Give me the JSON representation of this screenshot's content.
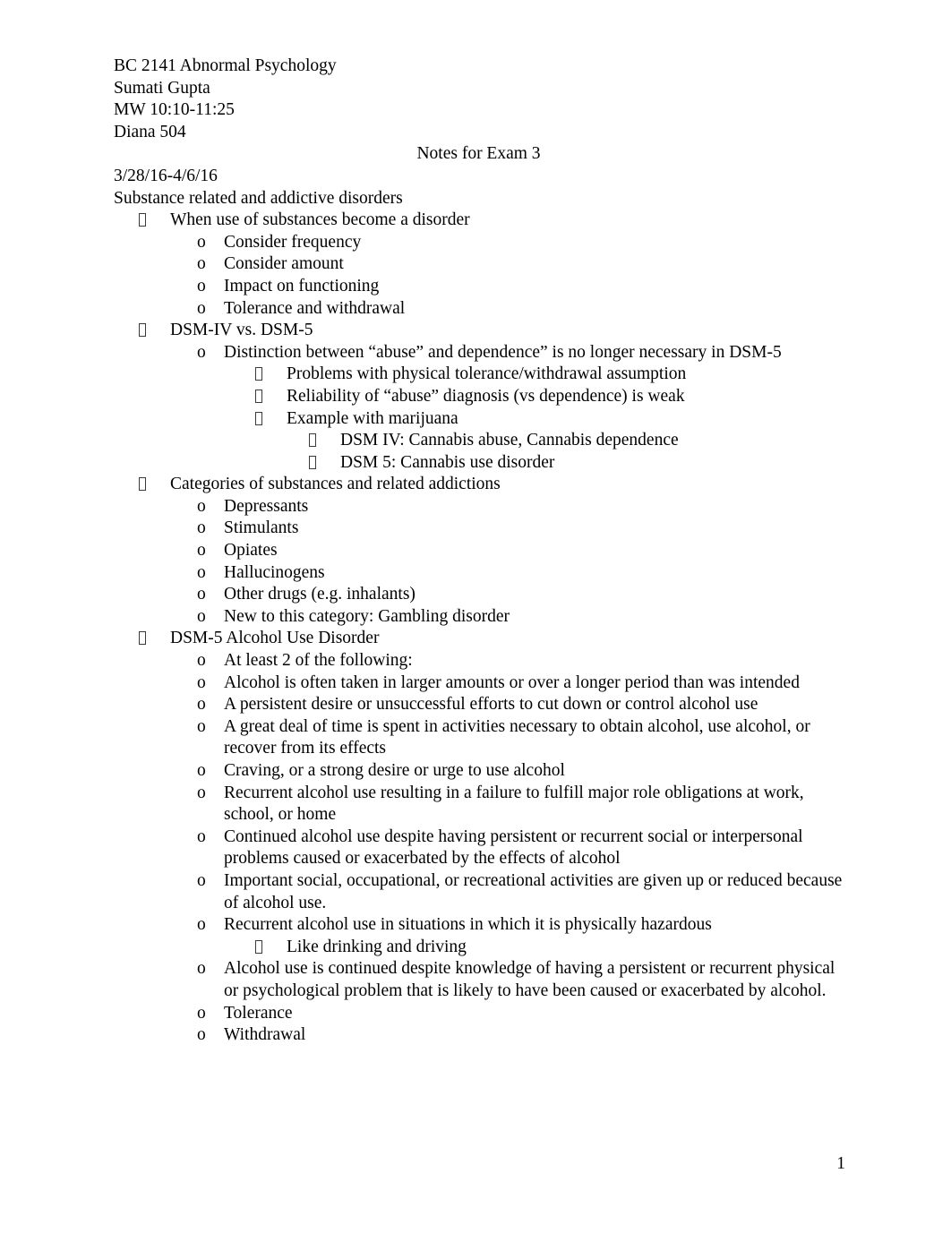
{
  "document": {
    "header": {
      "course": "BC 2141 Abnormal Psychology",
      "instructor": "Sumati Gupta",
      "schedule": "MW 10:10-11:25",
      "room": "Diana 504",
      "title": "Notes for Exam 3",
      "date_range": "3/28/16-4/6/16"
    },
    "section_heading": "Substance related and addictive disorders",
    "page_number": "1",
    "bullets": {
      "level1_glyph": "missing-glyph-box",
      "level2_glyph": "o",
      "level3_glyph": "missing-glyph-box",
      "level4_glyph": "missing-glyph-box"
    },
    "outline": [
      {
        "level": 1,
        "text": "When use of substances become a disorder"
      },
      {
        "level": 2,
        "text": "Consider frequency"
      },
      {
        "level": 2,
        "text": "Consider amount"
      },
      {
        "level": 2,
        "text": "Impact on functioning"
      },
      {
        "level": 2,
        "text": "Tolerance and withdrawal"
      },
      {
        "level": 1,
        "text": "DSM-IV vs. DSM-5"
      },
      {
        "level": 2,
        "text": "Distinction between “abuse” and dependence” is no longer necessary in DSM-5"
      },
      {
        "level": 3,
        "text": "Problems with physical tolerance/withdrawal assumption"
      },
      {
        "level": 3,
        "text": "Reliability of “abuse” diagnosis (vs dependence) is weak"
      },
      {
        "level": 3,
        "text": "Example with marijuana"
      },
      {
        "level": 4,
        "text": "DSM IV: Cannabis abuse, Cannabis dependence"
      },
      {
        "level": 4,
        "text": "DSM 5: Cannabis use disorder"
      },
      {
        "level": 1,
        "text": "Categories of substances and related addictions"
      },
      {
        "level": 2,
        "text": "Depressants"
      },
      {
        "level": 2,
        "text": "Stimulants"
      },
      {
        "level": 2,
        "text": "Opiates"
      },
      {
        "level": 2,
        "text": "Hallucinogens"
      },
      {
        "level": 2,
        "text": "Other drugs (e.g. inhalants)"
      },
      {
        "level": 2,
        "text": "New to this category: Gambling disorder"
      },
      {
        "level": 1,
        "text": "DSM-5 Alcohol Use Disorder"
      },
      {
        "level": 2,
        "text": "At least 2 of the following:"
      },
      {
        "level": 2,
        "text": "Alcohol is often taken in larger amounts or over a longer period than was intended"
      },
      {
        "level": 2,
        "text": "A persistent desire or unsuccessful efforts to cut down or control alcohol use"
      },
      {
        "level": 2,
        "text": "A great deal of time is spent in activities necessary to obtain alcohol, use alcohol, or recover from its effects"
      },
      {
        "level": 2,
        "text": "Craving, or a strong desire or urge to use alcohol"
      },
      {
        "level": 2,
        "text": "Recurrent alcohol use resulting in a failure to fulfill major role obligations at work, school, or home"
      },
      {
        "level": 2,
        "text": "Continued alcohol use despite having persistent or recurrent social or interpersonal problems caused or exacerbated by the effects of alcohol"
      },
      {
        "level": 2,
        "text": "Important social, occupational, or recreational activities are given up or reduced because of alcohol use."
      },
      {
        "level": 2,
        "text": "Recurrent alcohol use in situations in which it is physically hazardous"
      },
      {
        "level": 3,
        "text": "Like drinking and driving"
      },
      {
        "level": 2,
        "text": "Alcohol use is continued despite knowledge of having a persistent or recurrent physical or psychological problem that is likely to have been caused or exacerbated by alcohol."
      },
      {
        "level": 2,
        "text": "Tolerance"
      },
      {
        "level": 2,
        "text": "Withdrawal"
      }
    ]
  }
}
